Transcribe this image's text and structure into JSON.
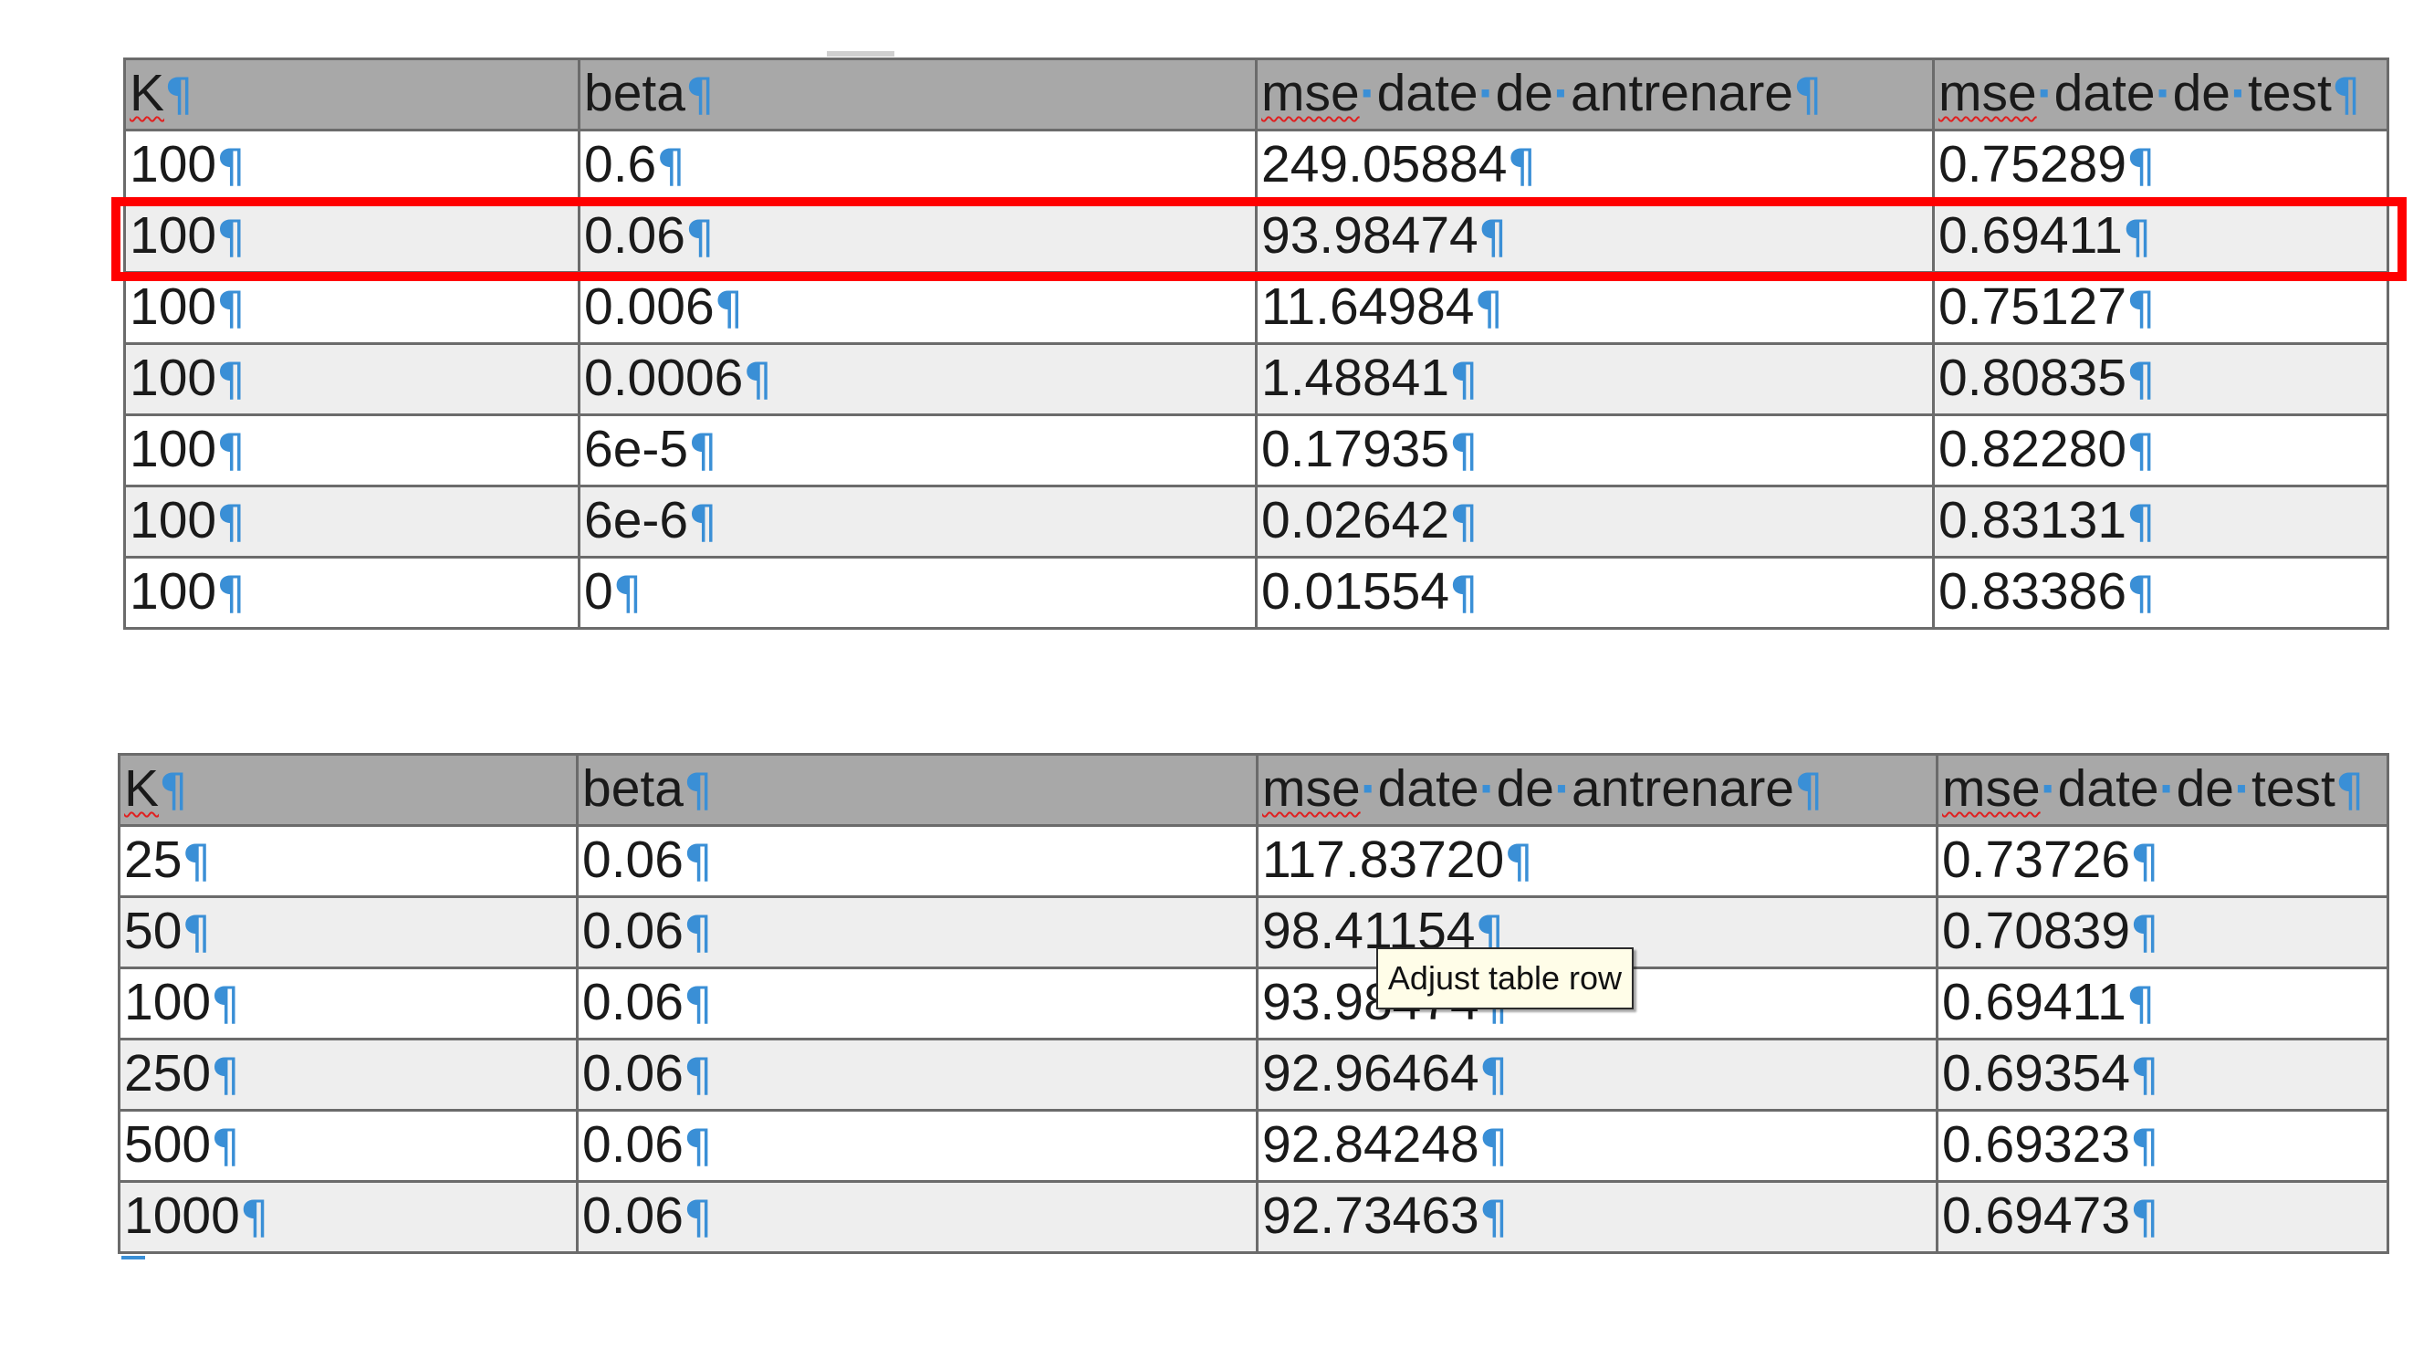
{
  "tables": [
    {
      "headers": [
        "K",
        "beta",
        "mse date de antrenare",
        "mse date de test"
      ],
      "rows": [
        [
          "100",
          "0.6",
          "249.05884",
          "0.75289"
        ],
        [
          "100",
          "0.06",
          "93.98474",
          "0.69411"
        ],
        [
          "100",
          "0.006",
          "11.64984",
          "0.75127"
        ],
        [
          "100",
          "0.0006",
          "1.48841",
          "0.80835"
        ],
        [
          "100",
          "6e-5",
          "0.17935",
          "0.82280"
        ],
        [
          "100",
          "6e-6",
          "0.02642",
          "0.83131"
        ],
        [
          "100",
          "0",
          "0.01554",
          "0.83386"
        ]
      ]
    },
    {
      "headers": [
        "K",
        "beta",
        "mse date de antrenare",
        "mse date de test"
      ],
      "rows": [
        [
          "25",
          "0.06",
          "117.83720",
          "0.73726"
        ],
        [
          "50",
          "0.06",
          "98.41154",
          "0.70839"
        ],
        [
          "100",
          "0.06",
          "93.98474",
          "0.69411"
        ],
        [
          "250",
          "0.06",
          "92.96464",
          "0.69354"
        ],
        [
          "500",
          "0.06",
          "92.84248",
          "0.69323"
        ],
        [
          "1000",
          "0.06",
          "92.73463",
          "0.69473"
        ]
      ]
    }
  ],
  "highlight": {
    "table": 0,
    "row": 1,
    "color": "#ff0000"
  },
  "tooltip": {
    "text": "Adjust table row"
  },
  "colors": {
    "header_bg": "#a8a8a8",
    "shaded_row_bg": "#eeeeee",
    "formatting_marks": "#3a8fd6",
    "spellcheck_underline": "#e02020"
  },
  "formatting_mark_icon": "pilcrow-icon"
}
